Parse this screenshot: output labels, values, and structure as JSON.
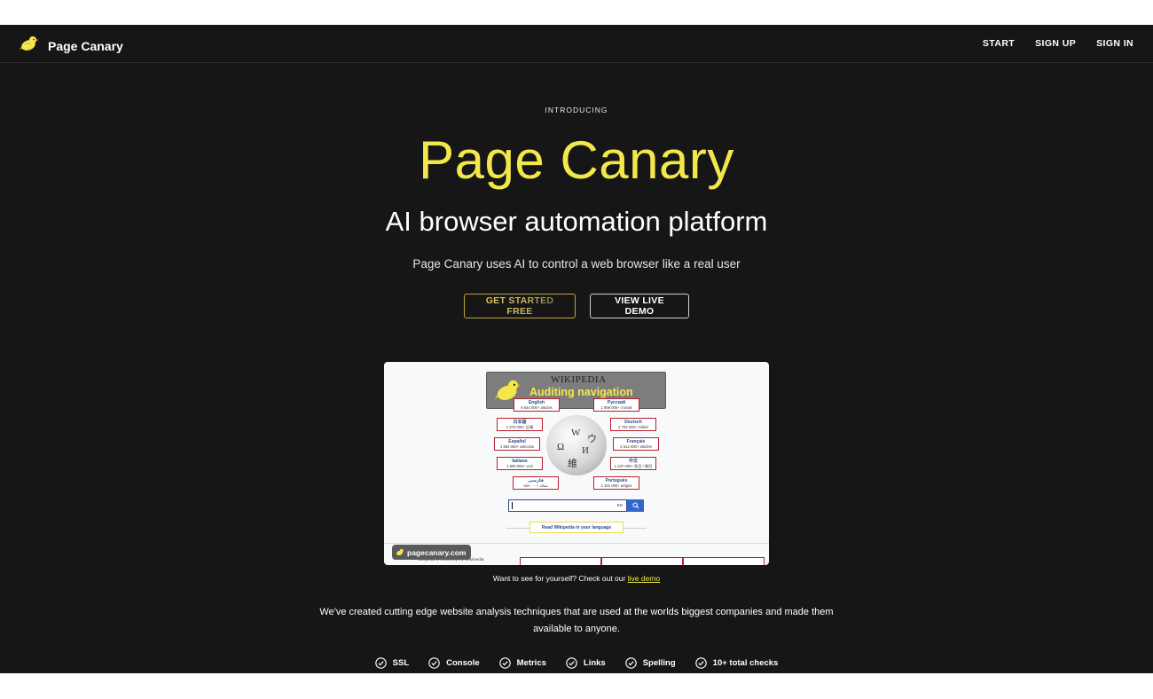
{
  "nav": {
    "brand": "Page Canary",
    "links": [
      "START",
      "SIGN UP",
      "SIGN IN"
    ]
  },
  "hero": {
    "eyebrow": "INTRODUCING",
    "title": "Page Canary",
    "subtitle": "AI browser automation platform",
    "description": "Page Canary uses AI to control a web browser like a real user",
    "primary_button": "GET STARTED FREE",
    "secondary_button": "VIEW LIVE DEMO"
  },
  "preview": {
    "wiki_title": "WIKIPEDIA",
    "overlay_text": "Auditing navigation",
    "languages": [
      {
        "name": "English",
        "count": "6 644 000+ articles"
      },
      {
        "name": "Русский",
        "count": "1 909 000+ статей"
      },
      {
        "name": "日本語",
        "count": "1 370 000+ 記事"
      },
      {
        "name": "Deutsch",
        "count": "2 792 000+ Artikel"
      },
      {
        "name": "Español",
        "count": "1 854 000+ artículos"
      },
      {
        "name": "Français",
        "count": "2 514 000+ articles"
      },
      {
        "name": "Italiano",
        "count": "1 806 000+ voci"
      },
      {
        "name": "中文",
        "count": "1 347 000+ 条目 / 條目"
      },
      {
        "name": "فارسی",
        "count": "۹۵۹ ۰۰۰+ مقاله"
      },
      {
        "name": "Português",
        "count": "1 101 000+ artigos"
      }
    ],
    "search_lang": "EN",
    "read_pill": "Read Wikipedia in your language",
    "badge": "pagecanary.com",
    "footer_text": "Wikipedia is hosted by the Wikimedia"
  },
  "demo": {
    "prefix": "Want to see for yourself? Check out our",
    "link": "live demo"
  },
  "body_text": "We've created cutting edge website analysis techniques that are used at the worlds biggest companies and made them available to anyone.",
  "checks": [
    "SSL",
    "Console",
    "Metrics",
    "Links",
    "Spelling",
    "10+ total checks"
  ],
  "colors": {
    "background": "#161616",
    "accent": "#f3e84a",
    "text": "#ffffff"
  }
}
